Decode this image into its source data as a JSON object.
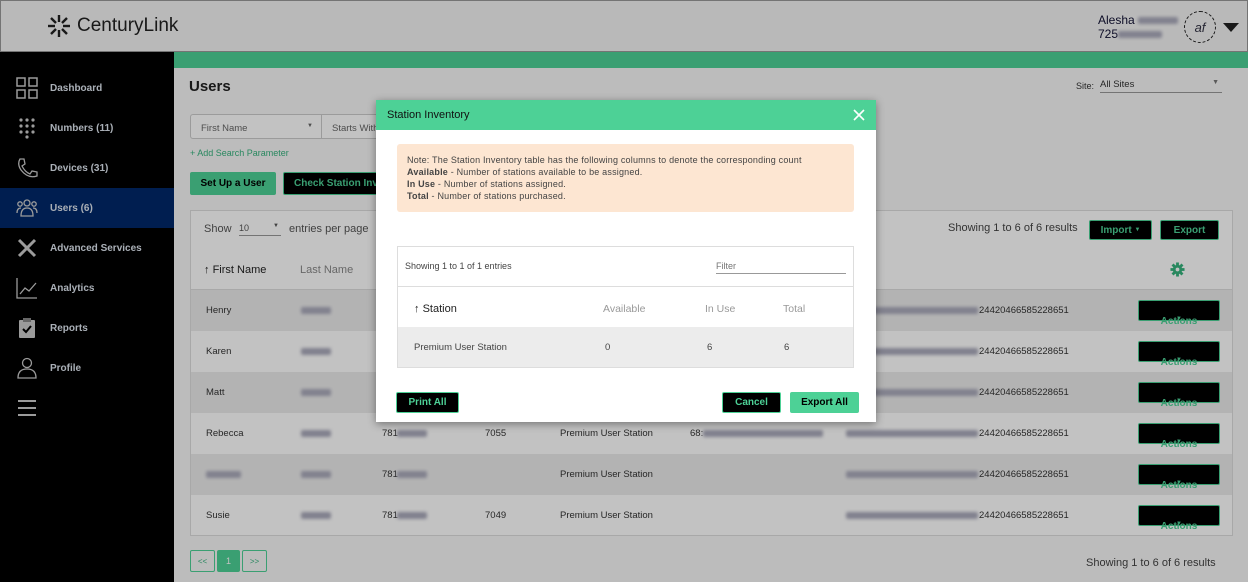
{
  "header": {
    "brand": "CenturyLink",
    "user_first": "Alesha",
    "user_phone_prefix": "725",
    "avatar_initials": "af"
  },
  "sidebar": {
    "items": [
      {
        "label": "Dashboard",
        "icon": "dashboard-icon"
      },
      {
        "label": "Numbers (11)",
        "icon": "dialpad-icon"
      },
      {
        "label": "Devices (31)",
        "icon": "phone-icon"
      },
      {
        "label": "Users (6)",
        "icon": "users-icon",
        "active": true
      },
      {
        "label": "Advanced Services",
        "icon": "tools-icon"
      },
      {
        "label": "Analytics",
        "icon": "analytics-icon"
      },
      {
        "label": "Reports",
        "icon": "clipboard-icon"
      },
      {
        "label": "Profile",
        "icon": "person-icon"
      }
    ]
  },
  "page": {
    "title": "Users",
    "site_label": "Site:",
    "site_value": "All Sites",
    "search_field": "First Name",
    "search_op": "Starts With",
    "add_param": "+ Add Search Parameter",
    "setup_user": "Set Up a User",
    "check_inventory": "Check Station Inventory",
    "show": "Show",
    "per_page": "10",
    "entries_per_page": "entries per page",
    "results": "Showing 1 to 6 of 6 results",
    "import": "Import",
    "export": "Export",
    "col_first": "First Name",
    "col_last": "Last Name",
    "rows": [
      {
        "first": "Henry",
        "phone": "",
        "ext": "",
        "station": "",
        "id": "24420466585228651"
      },
      {
        "first": "Karen",
        "phone": "",
        "ext": "",
        "station": "",
        "id": "24420466585228651"
      },
      {
        "first": "Matt",
        "phone": "",
        "ext": "",
        "station": "",
        "id": "24420466585228651"
      },
      {
        "first": "Rebecca",
        "phone": "781",
        "ext": "7055",
        "station": "Premium User Station",
        "mac": "68:",
        "id": "24420466585228651"
      },
      {
        "first": "",
        "phone": "781",
        "ext": "",
        "station": "Premium User Station",
        "id": "24420466585228651"
      },
      {
        "first": "Susie",
        "phone": "781",
        "ext": "7049",
        "station": "Premium User Station",
        "id": "24420466585228651"
      }
    ],
    "actions": "Actions",
    "pager": {
      "prev": "<<",
      "current": "1",
      "next": ">>"
    },
    "footer_results": "Showing 1 to 6 of 6 results"
  },
  "modal": {
    "title": "Station Inventory",
    "note_intro": "Note: The Station Inventory table has the following columns to denote the corresponding count",
    "notes": [
      {
        "term": "Available",
        "desc": " - Number of stations available to be assigned."
      },
      {
        "term": "In Use",
        "desc": " - Number of stations assigned."
      },
      {
        "term": "Total",
        "desc": " - Number of stations purchased."
      }
    ],
    "showing": "Showing 1 to 1 of 1 entries",
    "filter_placeholder": "Filter",
    "columns": [
      "Station",
      "Available",
      "In Use",
      "Total"
    ],
    "row": {
      "station": "Premium User Station",
      "available": "0",
      "in_use": "6",
      "total": "6"
    },
    "print_all": "Print All",
    "cancel": "Cancel",
    "export_all": "Export All"
  },
  "colors": {
    "accent": "#4dd196",
    "sidebar_active": "#00286a",
    "note_bg": "#fde6d2"
  }
}
